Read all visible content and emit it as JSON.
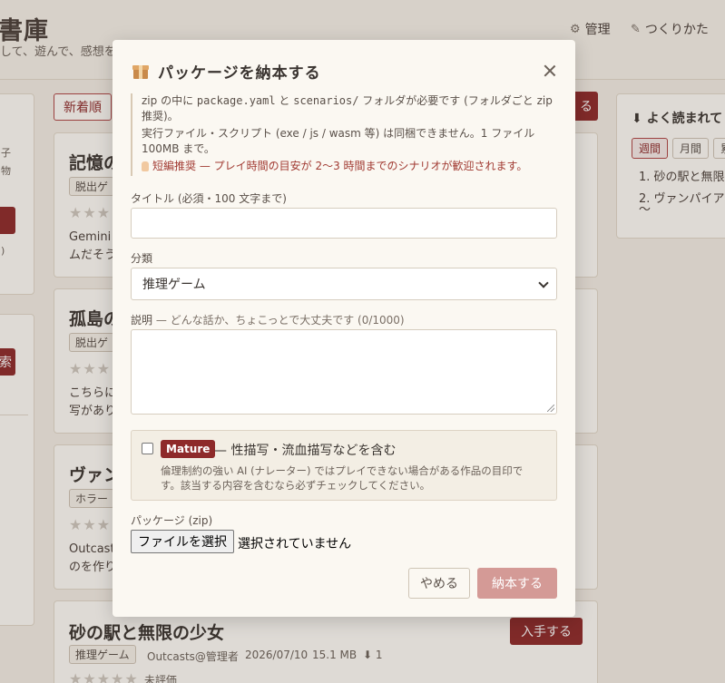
{
  "background": {
    "site_title": "書庫",
    "site_subtitle": "して、遊んで、感想を",
    "nav": [
      {
        "label": "管理",
        "icon": "gear-icon"
      },
      {
        "label": "つくりかた",
        "icon": "pen-icon"
      }
    ],
    "left_panel": {
      "text_1": "子",
      "text_2": "物",
      "text_3": ")",
      "button_2": "索"
    },
    "sort_chip": "新着順",
    "header_button": "る",
    "cards": [
      {
        "title": "記憶の",
        "tag": "脱出ゲ",
        "stars": "★★★",
        "desc_1": "Gemini",
        "desc_2": "ムだそう"
      },
      {
        "title": "孤島の",
        "tag": "脱出ゲ",
        "stars": "★★★",
        "desc_1": "こちらに",
        "desc_2": "写があり"
      },
      {
        "title": "ヴァン",
        "tag": "ホラー",
        "stars": "★★★",
        "desc_1": "Outcast",
        "desc_2": "のを作り"
      },
      {
        "title": "砂の駅と無限の少女",
        "tag": "推理ゲーム",
        "stars": "★★★★★",
        "rating_label": "未評価",
        "author": "Outcasts@管理者",
        "date": "2026/07/10",
        "size": "15.1 MB",
        "downloads": "⬇ 1",
        "button": "入手する"
      }
    ],
    "sidebar": {
      "title": "⬇ よく読まれて",
      "tabs": [
        "週間",
        "月間",
        "累"
      ],
      "items": [
        "1.  砂の駅と無限",
        "2.  ヴァンパイア",
        "      〜"
      ]
    }
  },
  "modal": {
    "title": "パッケージを納本する",
    "notice": {
      "line1_a": "zip の中に ",
      "line1_code1": "package.yaml",
      "line1_b": " と ",
      "line1_code2": "scenarios/",
      "line1_c": " フォルダが必要です (フォルダごと zip 推奨)。",
      "line2": "実行ファイル・スクリプト (exe / js / wasm 等) は同梱できません。1 ファイル 100MB まで。",
      "line3": "短編推奨 — プレイ時間の目安が 2〜3 時間までのシナリオが歓迎されます。"
    },
    "title_field": {
      "label": "タイトル (必須・100 文字まで)",
      "value": "",
      "placeholder": ""
    },
    "category_field": {
      "label": "分類",
      "selected": "推理ゲーム"
    },
    "description_field": {
      "label": "説明",
      "hint": " — どんな話か、ちょこっとで大丈夫です (0/1000)",
      "value": ""
    },
    "mature": {
      "checked": false,
      "badge": "Mature",
      "text": "— 性描写・流血描写などを含む",
      "note": "倫理制約の強い AI (ナレーター) ではプレイできない場合がある作品の目印です。該当する内容を含むなら必ずチェックしてください。"
    },
    "package_field": {
      "label": "パッケージ (zip)",
      "button": "ファイルを選択",
      "status": "選択されていません"
    },
    "buttons": {
      "cancel": "やめる",
      "submit": "納本する"
    }
  },
  "colors": {
    "accent": "#8e2a2a",
    "submit_disabled": "#d49a96",
    "warn_text": "#a13a32"
  }
}
